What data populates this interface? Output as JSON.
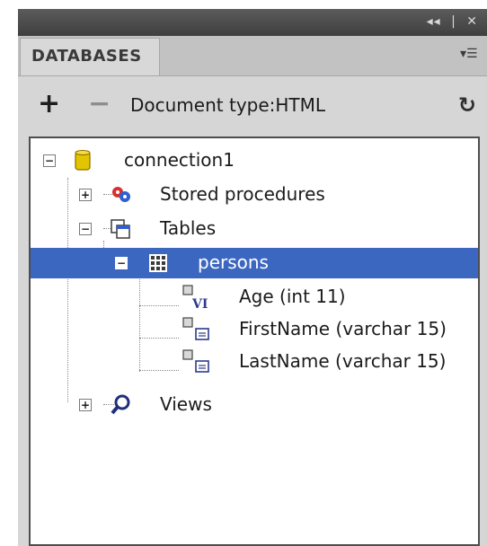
{
  "panel": {
    "title": "DATABASES",
    "controls": [
      "◂◂",
      "|",
      "✕"
    ],
    "menu_icon": "panel-menu-icon"
  },
  "toolbar": {
    "add_label": "+",
    "remove_label": "−",
    "doctype_label": "Document type:HTML",
    "refresh_label": "↻"
  },
  "tree": {
    "connection": "connection1",
    "stored_procedures": "Stored procedures",
    "tables": "Tables",
    "table_name": "persons",
    "columns": [
      "Age (int 11)",
      "FirstName (varchar 15)",
      "LastName (varchar 15)"
    ],
    "views": "Views"
  },
  "colors": {
    "selection": "#3c67c0",
    "titlebar": "#4a4a4a",
    "panel_bg": "#d6d6d6"
  }
}
